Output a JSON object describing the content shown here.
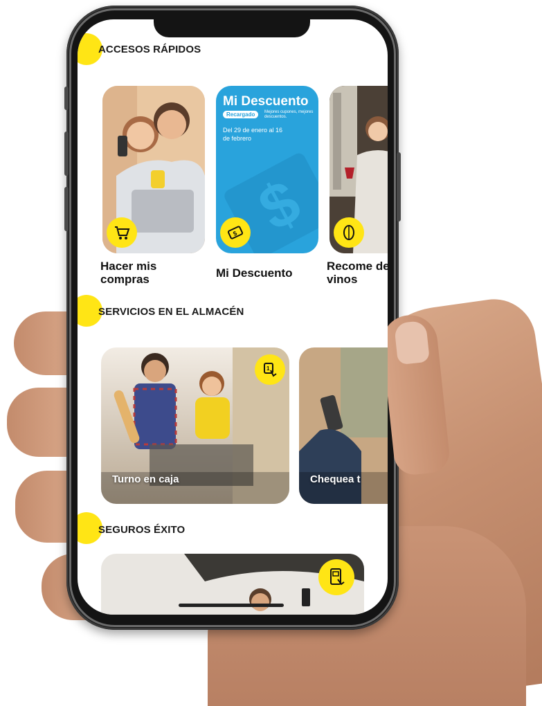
{
  "sections": {
    "quick_access": {
      "title": "ACCESOS RÁPIDOS",
      "cards": [
        {
          "label": "Hacer mis compras",
          "icon": "shopping-cart-icon"
        },
        {
          "label": "Mi Descuento",
          "icon": "discount-ticket-icon",
          "promo": {
            "heading": "Mi Descuento",
            "tag": "Recargado",
            "tagline": "Mejores cupones, mejores descuentos.",
            "dates": "Del 29 de enero al 16 de febrero"
          }
        },
        {
          "label": "Recome de vinos",
          "icon": "wine-icon"
        }
      ]
    },
    "store_services": {
      "title": "SERVICIOS EN EL ALMACÉN",
      "cards": [
        {
          "label": "Turno en caja",
          "icon": "touch-ticket-icon"
        },
        {
          "label": "Chequea t",
          "icon": ""
        }
      ]
    },
    "insurance": {
      "title": "SEGUROS ÉXITO",
      "cards": [
        {
          "label": "",
          "icon": "phone-document-icon"
        }
      ]
    }
  },
  "colors": {
    "accent": "#ffe515",
    "promo_blue": "#29a3dc"
  }
}
